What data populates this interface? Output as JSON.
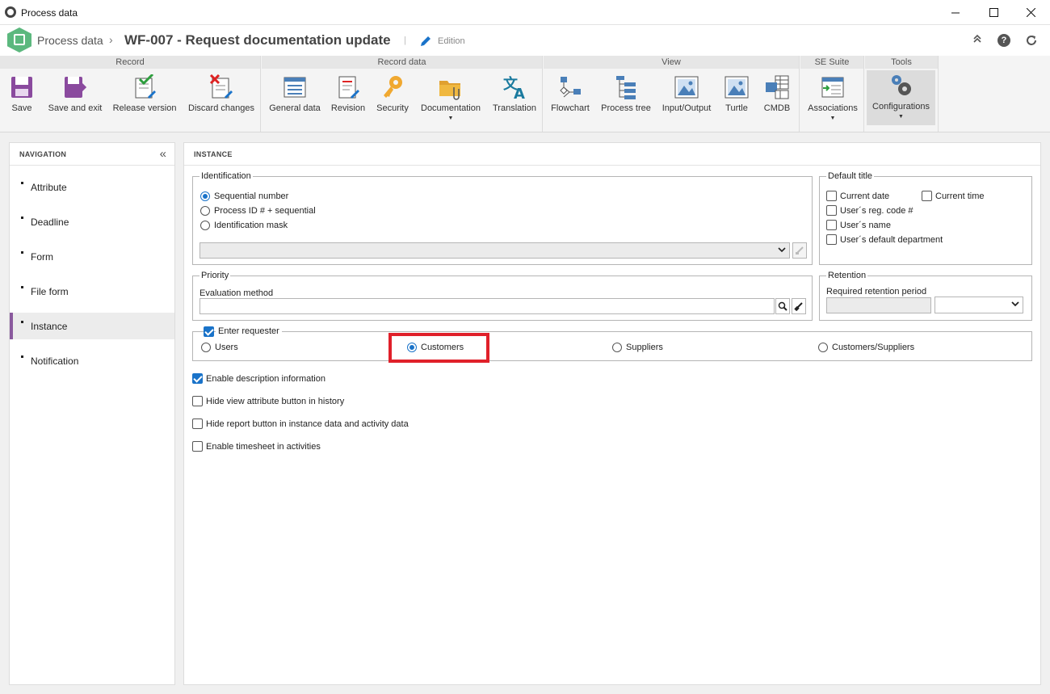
{
  "window": {
    "title": "Process data"
  },
  "header": {
    "breadcrumb_root": "Process data",
    "breadcrumb_sep": "›",
    "title": "WF-007 - Request documentation update",
    "separator": "|",
    "mode_label": "Edition"
  },
  "ribbon": {
    "groups": {
      "record": "Record",
      "record_data": "Record data",
      "view": "View",
      "se_suite": "SE Suite",
      "tools": "Tools"
    },
    "buttons": {
      "save": "Save",
      "save_exit": "Save and exit",
      "release_version": "Release version",
      "discard_changes": "Discard changes",
      "general_data": "General data",
      "revision": "Revision",
      "security": "Security",
      "documentation": "Documentation",
      "translation": "Translation",
      "flowchart": "Flowchart",
      "process_tree": "Process tree",
      "input_output": "Input/Output",
      "turtle": "Turtle",
      "cmdb": "CMDB",
      "associations": "Associations",
      "configurations": "Configurations"
    }
  },
  "navigation": {
    "title": "NAVIGATION",
    "items": [
      "Attribute",
      "Deadline",
      "Form",
      "File form",
      "Instance",
      "Notification"
    ],
    "active": "Instance"
  },
  "instance": {
    "title": "INSTANCE",
    "identification": {
      "legend": "Identification",
      "options": [
        "Sequential number",
        "Process ID # + sequential",
        "Identification mask"
      ],
      "selected": "Sequential number",
      "mask_value": ""
    },
    "default_title": {
      "legend": "Default title",
      "current_date": "Current date",
      "current_time": "Current time",
      "reg_code": "User´s reg. code #",
      "user_name": "User´s name",
      "default_department": "User´s default department"
    },
    "priority": {
      "legend": "Priority",
      "evaluation_label": "Evaluation method",
      "evaluation_value": ""
    },
    "retention": {
      "legend": "Retention",
      "period_label": "Required retention period",
      "period_value": "",
      "unit_value": ""
    },
    "requester": {
      "legend": "Enter requester",
      "checked": true,
      "options": [
        "Users",
        "Customers",
        "Suppliers",
        "Customers/Suppliers"
      ],
      "selected": "Customers"
    },
    "options": {
      "enable_description": "Enable description information",
      "hide_view_attribute": "Hide view attribute button in history",
      "hide_report": "Hide report button in instance data and activity data",
      "enable_timesheet": "Enable timesheet in activities"
    }
  },
  "colors": {
    "accent": "#1a73c9",
    "highlight": "#e0202a",
    "logo": "#5cb87e",
    "nav_active": "#8a5a9e"
  }
}
